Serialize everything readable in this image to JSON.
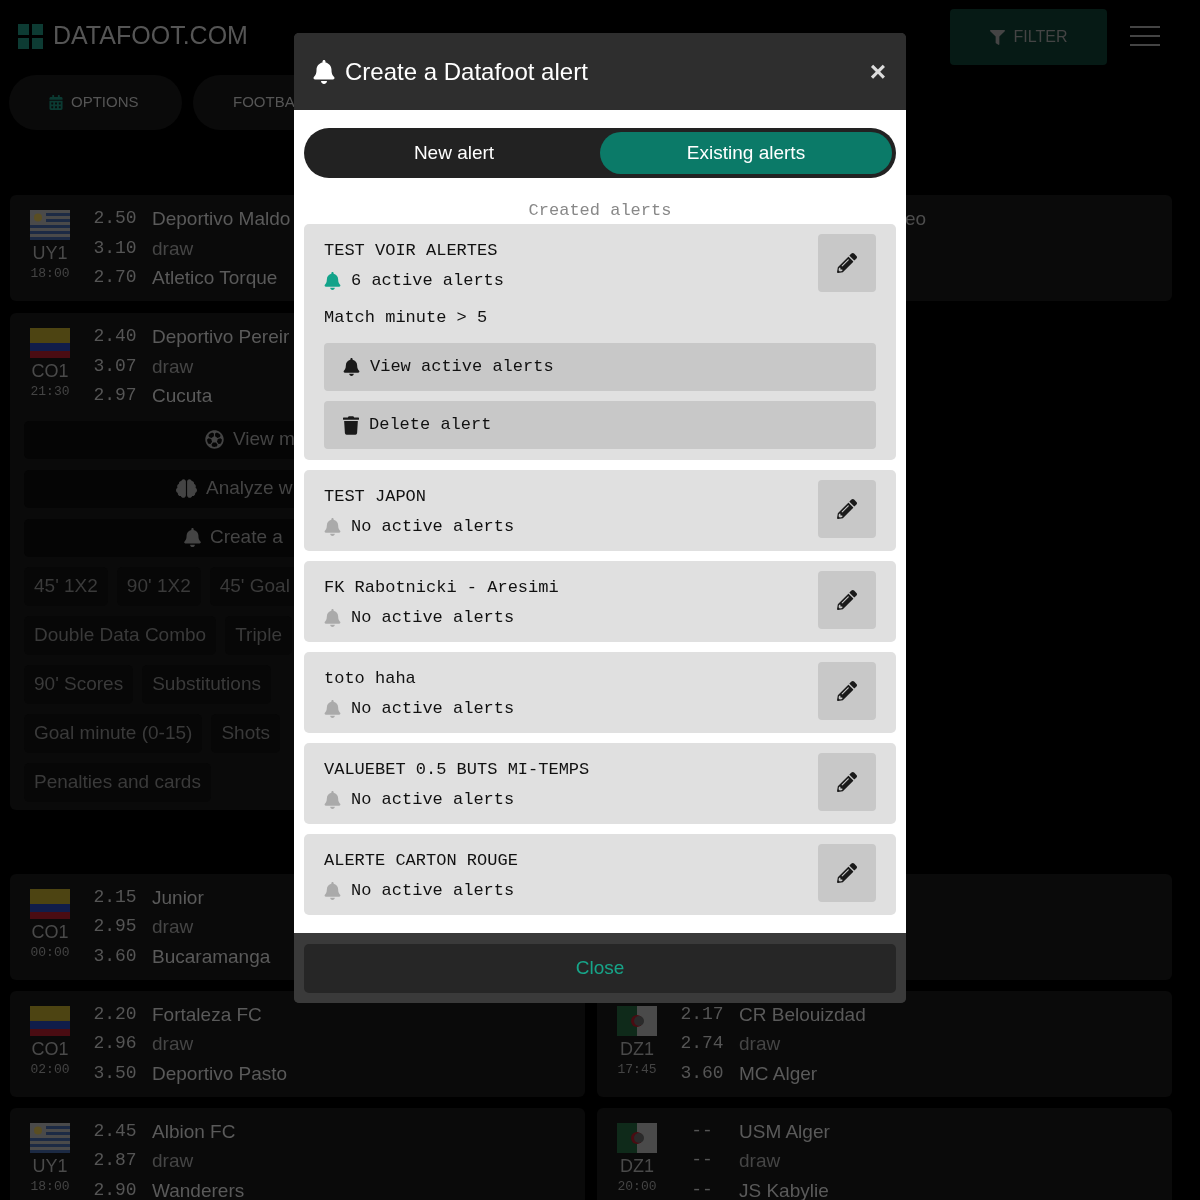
{
  "header": {
    "logo": "DATAFOOT.COM",
    "filter_button": "FILTER"
  },
  "pills": [
    {
      "kind": "options",
      "label": "OPTIONS"
    },
    {
      "kind": "plain",
      "label": "FOOTBA"
    }
  ],
  "top_section": {
    "left": [
      {
        "kind": "match",
        "flag": {
          "kind": "uruguay"
        },
        "league": "UY1",
        "time": "18:00",
        "odds": [
          "2.50",
          "3.10",
          "2.70"
        ],
        "teams": [
          "Deportivo Maldo",
          "draw",
          "Atletico Torque"
        ]
      },
      {
        "kind": "match",
        "flag": {
          "kind": "colombia"
        },
        "league": "CO1",
        "time": "21:30",
        "odds": [
          "2.40",
          "3.07",
          "2.97"
        ],
        "teams": [
          "Deportivo Pereir",
          "draw",
          "Cucuta"
        ],
        "actions": [
          {
            "kind": "ball",
            "label": "View m"
          },
          {
            "kind": "brain",
            "label": "Analyze w"
          },
          {
            "kind": "bell",
            "label": "Create a"
          }
        ],
        "markets": [
          [
            "45' 1X2",
            "90' 1X2",
            "45' Goal"
          ],
          [
            "Double Data Combo",
            "Triple"
          ],
          [
            "90' Scores",
            "Substitutions"
          ],
          [
            "Goal minute (0-15)",
            "Shots"
          ],
          [
            "Penalties and cards"
          ]
        ]
      }
    ],
    "right": [
      {
        "kind": "covered",
        "teams": [
          "eo"
        ]
      }
    ]
  },
  "bottom_rows": [
    {
      "left": {
        "kind": "match",
        "flag": {
          "kind": "colombia"
        },
        "league": "CO1",
        "time": "00:00",
        "odds": [
          "2.15",
          "2.95",
          "3.60"
        ],
        "teams": [
          "Junior",
          "draw",
          "Bucaramanga"
        ]
      },
      "right": {
        "kind": "covered"
      }
    },
    {
      "left": {
        "kind": "match",
        "flag": {
          "kind": "colombia"
        },
        "league": "CO1",
        "time": "02:00",
        "odds": [
          "2.20",
          "2.96",
          "3.50"
        ],
        "teams": [
          "Fortaleza FC",
          "draw",
          "Deportivo Pasto"
        ]
      },
      "right": {
        "kind": "match",
        "flag": {
          "kind": "algeria"
        },
        "league": "DZ1",
        "time": "17:45",
        "odds": [
          "2.17",
          "2.74",
          "3.60"
        ],
        "teams": [
          "CR Belouizdad",
          "draw",
          "MC Alger"
        ]
      }
    },
    {
      "left": {
        "kind": "match",
        "flag": {
          "kind": "uruguay"
        },
        "league": "UY1",
        "time": "18:00",
        "odds": [
          "2.45",
          "2.87",
          "2.90"
        ],
        "teams": [
          "Albion FC",
          "draw",
          "Wanderers"
        ]
      },
      "right": {
        "kind": "match",
        "flag": {
          "kind": "algeria"
        },
        "league": "DZ1",
        "time": "20:00",
        "odds": [
          "--",
          "--",
          "--"
        ],
        "teams": [
          "USM Alger",
          "draw",
          "JS Kabylie"
        ]
      }
    }
  ],
  "modal": {
    "title": "Create a Datafoot alert",
    "close": "×",
    "tabs": [
      {
        "label": "New alert",
        "selected": false
      },
      {
        "label": "Existing alerts",
        "selected": true
      }
    ],
    "section_title": "Created alerts",
    "alerts": [
      {
        "name": "TEST VOIR ALERTES",
        "active": true,
        "status": "6 active alerts",
        "condition": "Match minute > 5",
        "actions": [
          {
            "kind": "view",
            "label": "View active alerts"
          },
          {
            "kind": "delete",
            "label": "Delete alert"
          }
        ]
      },
      {
        "name": "TEST JAPON",
        "active": false,
        "status": "No active alerts"
      },
      {
        "name": "FK Rabotnicki - Aresimi",
        "active": false,
        "status": "No active alerts"
      },
      {
        "name": "toto haha",
        "active": false,
        "status": "No active alerts"
      },
      {
        "name": "VALUEBET 0.5 BUTS MI-TEMPS",
        "active": false,
        "status": "No active alerts"
      },
      {
        "name": "ALERTE CARTON ROUGE",
        "active": false,
        "status": "No active alerts"
      }
    ],
    "footer_button": "Close"
  }
}
